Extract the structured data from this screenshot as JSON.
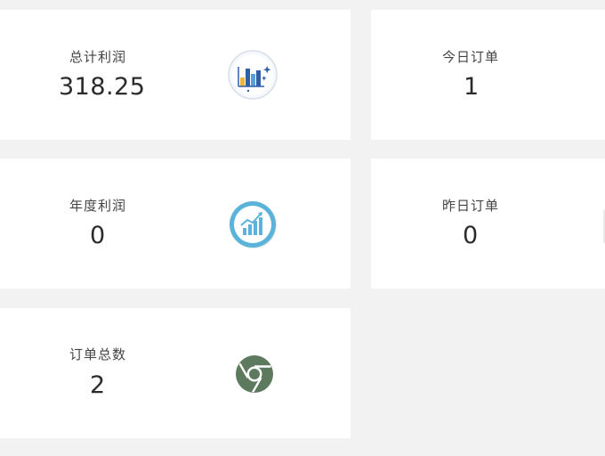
{
  "stats": {
    "total_profit": {
      "label": "总计利润",
      "value": "318.25",
      "icon": "bar-chart-icon"
    },
    "today_orders": {
      "label": "今日订单",
      "value": "1"
    },
    "annual_profit": {
      "label": "年度利润",
      "value": "0",
      "icon": "growth-chart-icon"
    },
    "yesterday_orders": {
      "label": "昨日订单",
      "value": "0"
    },
    "total_orders": {
      "label": "订单总数",
      "value": "2",
      "icon": "chrome-icon"
    }
  },
  "colors": {
    "background": "#f2f2f2",
    "card": "#ffffff",
    "chrome_icon": "#5d7a5f",
    "growth_icon": "#5ab3d9"
  }
}
